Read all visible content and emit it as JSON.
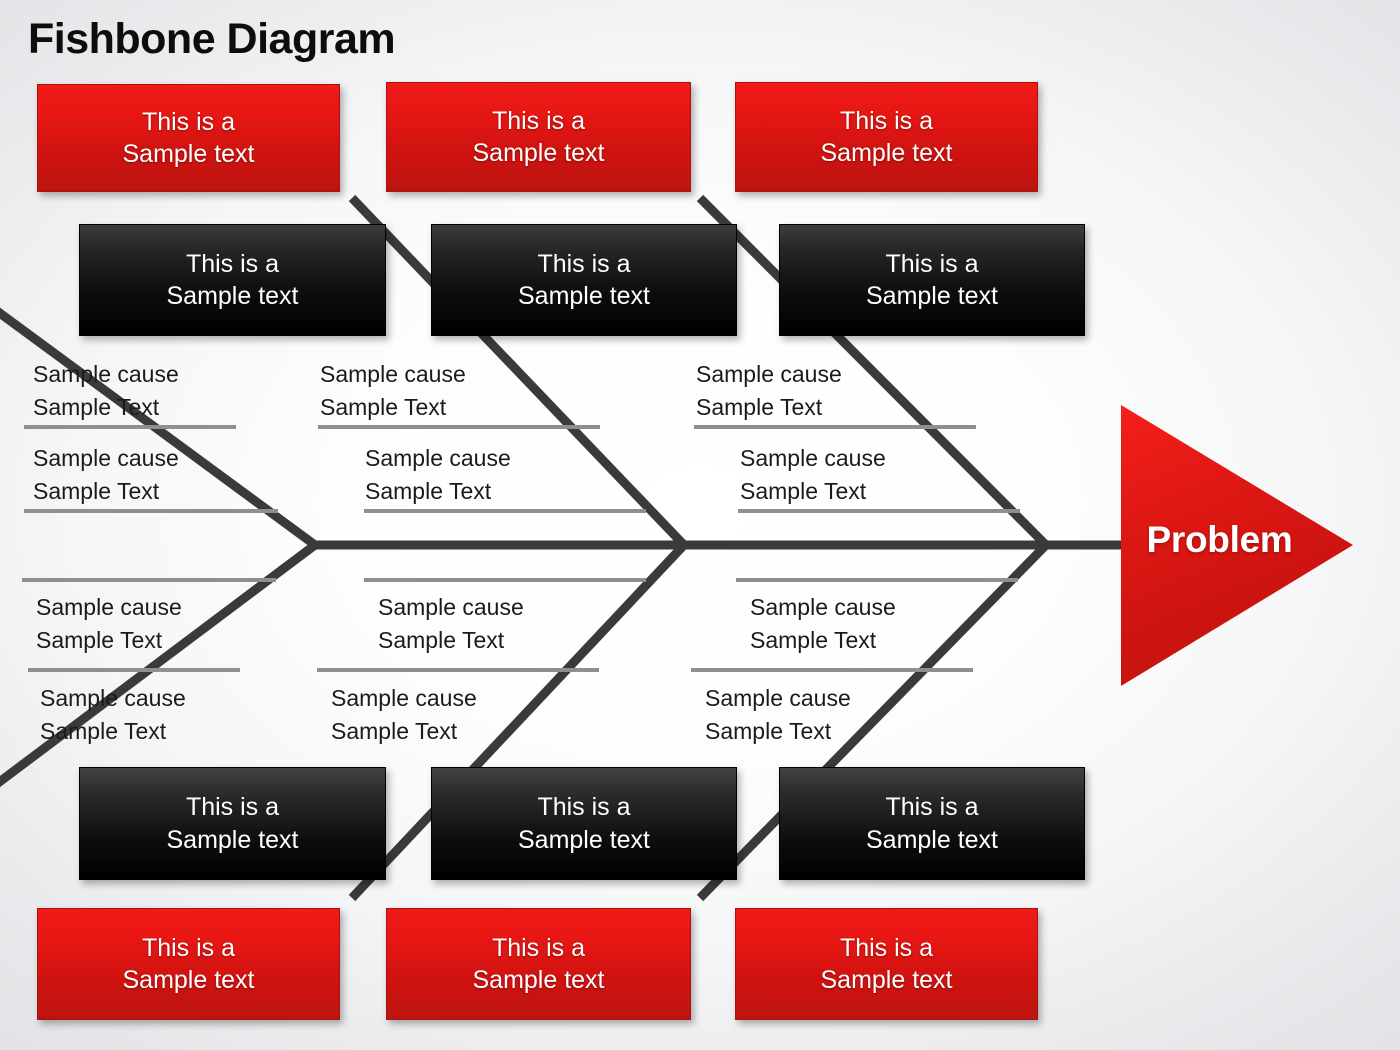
{
  "title": "Fishbone Diagram",
  "problem": {
    "label": "Problem"
  },
  "colors": {
    "red": "#e81714",
    "black": "#000000",
    "bone": "#3a3a3a",
    "rule": "#8f8f8f",
    "text": "#1b1b1b"
  },
  "category_boxes": {
    "top_red": [
      {
        "line1": "This is a",
        "line2": "Sample text"
      },
      {
        "line1": "This is a",
        "line2": "Sample text"
      },
      {
        "line1": "This is a",
        "line2": "Sample text"
      }
    ],
    "top_black": [
      {
        "line1": "This is a",
        "line2": "Sample text"
      },
      {
        "line1": "This is a",
        "line2": "Sample text"
      },
      {
        "line1": "This is a",
        "line2": "Sample text"
      }
    ],
    "bottom_black": [
      {
        "line1": "This is a",
        "line2": "Sample text"
      },
      {
        "line1": "This is a",
        "line2": "Sample text"
      },
      {
        "line1": "This is a",
        "line2": "Sample text"
      }
    ],
    "bottom_red": [
      {
        "line1": "This is a",
        "line2": "Sample text"
      },
      {
        "line1": "This is a",
        "line2": "Sample text"
      },
      {
        "line1": "This is a",
        "line2": "Sample text"
      }
    ]
  },
  "causes": {
    "upper": [
      {
        "line1": "Sample cause",
        "line2": "Sample Text"
      },
      {
        "line1": "Sample cause",
        "line2": "Sample Text"
      },
      {
        "line1": "Sample cause",
        "line2": "Sample Text"
      },
      {
        "line1": "Sample cause",
        "line2": "Sample Text"
      },
      {
        "line1": "Sample cause",
        "line2": "Sample Text"
      },
      {
        "line1": "Sample cause",
        "line2": "Sample Text"
      }
    ],
    "lower": [
      {
        "line1": "Sample cause",
        "line2": "Sample Text"
      },
      {
        "line1": "Sample cause",
        "line2": "Sample Text"
      },
      {
        "line1": "Sample cause",
        "line2": "Sample Text"
      },
      {
        "line1": "Sample cause",
        "line2": "Sample Text"
      },
      {
        "line1": "Sample cause",
        "line2": "Sample Text"
      },
      {
        "line1": "Sample cause",
        "line2": "Sample Text"
      }
    ]
  }
}
